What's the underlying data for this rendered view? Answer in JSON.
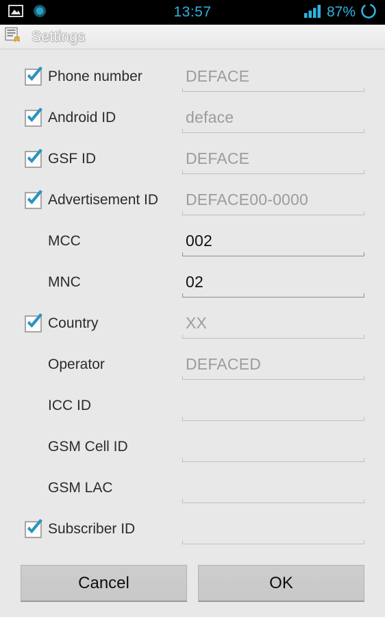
{
  "status_bar": {
    "clock": "13:57",
    "battery_percent": "87%",
    "left_icons": [
      "image-icon",
      "recording-dot-icon"
    ],
    "right_icons": [
      "signal-bars-icon",
      "battery-ring-icon"
    ],
    "accent_color": "#2fb3e0",
    "background_color": "#000000"
  },
  "title_bar": {
    "icon": "settings-document-icon",
    "title": "Settings"
  },
  "form": {
    "rows": [
      {
        "label": "Phone number",
        "checkbox": true,
        "checked": true,
        "value": "DEFACE",
        "filled": false
      },
      {
        "label": "Android ID",
        "checkbox": true,
        "checked": true,
        "value": "deface",
        "filled": false
      },
      {
        "label": "GSF ID",
        "checkbox": true,
        "checked": true,
        "value": "DEFACE",
        "filled": false
      },
      {
        "label": "Advertisement ID",
        "checkbox": true,
        "checked": true,
        "value": "DEFACE00-0000",
        "filled": false
      },
      {
        "label": "MCC",
        "checkbox": false,
        "checked": false,
        "value": "002",
        "filled": true
      },
      {
        "label": "MNC",
        "checkbox": false,
        "checked": false,
        "value": "02",
        "filled": true
      },
      {
        "label": "Country",
        "checkbox": true,
        "checked": true,
        "value": "XX",
        "filled": false
      },
      {
        "label": "Operator",
        "checkbox": false,
        "checked": false,
        "value": "DEFACED",
        "filled": false
      },
      {
        "label": "ICC ID",
        "checkbox": false,
        "checked": false,
        "value": "",
        "filled": false
      },
      {
        "label": "GSM Cell ID",
        "checkbox": false,
        "checked": false,
        "value": "",
        "filled": false
      },
      {
        "label": "GSM LAC",
        "checkbox": false,
        "checked": false,
        "value": "",
        "filled": false
      },
      {
        "label": "Subscriber ID",
        "checkbox": true,
        "checked": true,
        "value": "",
        "filled": false
      }
    ]
  },
  "buttons": {
    "cancel_label": "Cancel",
    "ok_label": "OK"
  }
}
